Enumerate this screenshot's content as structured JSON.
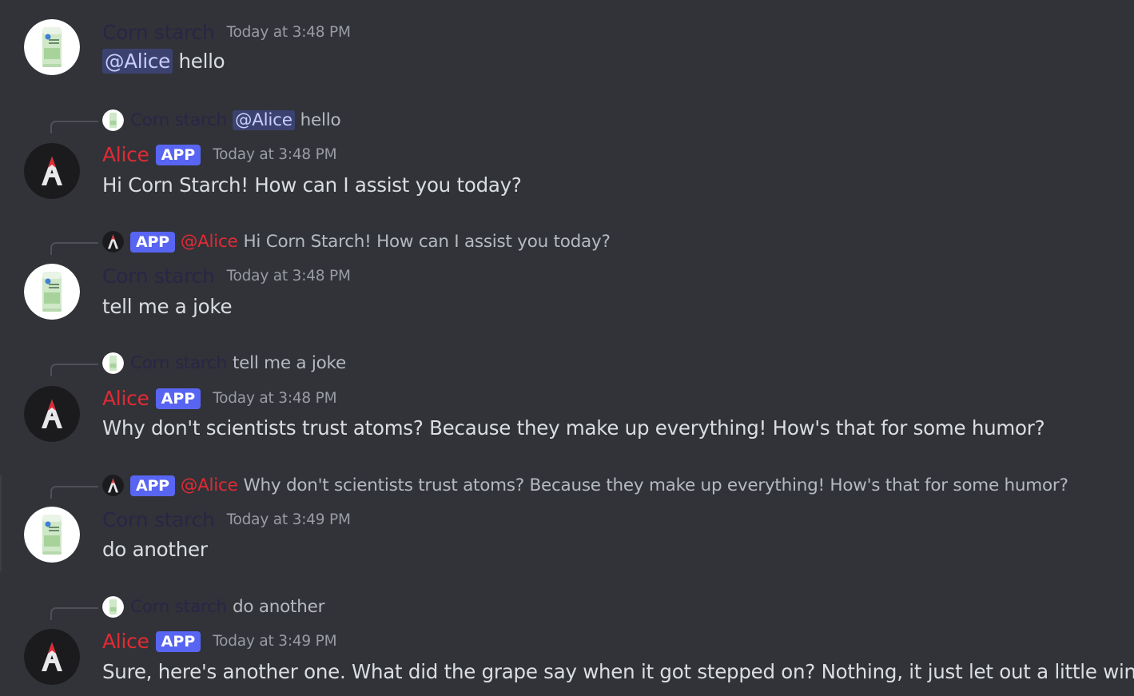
{
  "users": {
    "cornstarch": {
      "name": "Corn starch",
      "avatar_icon": "corn-starch-box-icon",
      "color": "#2a2546"
    },
    "alice": {
      "name": "Alice",
      "badge": "APP",
      "avatar_icon": "alice-a-logo-icon",
      "color": "#e22a34"
    }
  },
  "messages": [
    {
      "author": "Corn starch",
      "timestamp": "Today at 3:48 PM",
      "mention": "@Alice",
      "text": "hello"
    },
    {
      "reply": {
        "author": "Corn starch",
        "mention": "@Alice",
        "text": "hello"
      },
      "author": "Alice",
      "badge": "APP",
      "timestamp": "Today at 3:48 PM",
      "text": "Hi Corn Starch! How can I assist you today?"
    },
    {
      "reply": {
        "badge": "APP",
        "author": "@Alice",
        "text": "Hi Corn Starch! How can I assist you today?"
      },
      "author": "Corn starch",
      "timestamp": "Today at 3:48 PM",
      "text": "tell me a joke"
    },
    {
      "reply": {
        "author": "Corn starch",
        "text": "tell me a joke"
      },
      "author": "Alice",
      "badge": "APP",
      "timestamp": "Today at 3:48 PM",
      "text": "Why don't scientists trust atoms? Because they make up everything! How's that for some humor?"
    },
    {
      "reply": {
        "badge": "APP",
        "author": "@Alice",
        "text": "Why don't scientists trust atoms? Because they make up everything! How's that for some humor?"
      },
      "author": "Corn starch",
      "timestamp": "Today at 3:49 PM",
      "text": "do another"
    },
    {
      "reply": {
        "author": "Corn starch",
        "text": "do another"
      },
      "author": "Alice",
      "badge": "APP",
      "timestamp": "Today at 3:49 PM",
      "text": "Sure, here's another one. What did the grape say when it got stepped on? Nothing, it just let out a little wine!"
    }
  ],
  "colors": {
    "background": "#313338",
    "mention_bg": "#3c4270",
    "app_badge": "#5865f2",
    "text": "#dbdee1",
    "timestamp": "#9a9ca4"
  }
}
